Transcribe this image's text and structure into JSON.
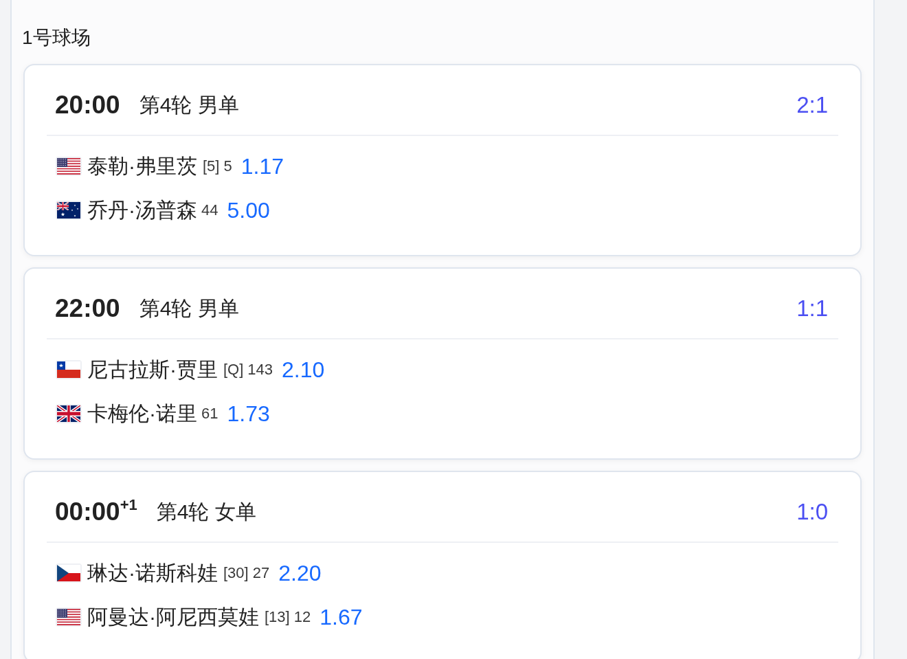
{
  "court": {
    "title": "1号球场"
  },
  "matches": [
    {
      "time": "20:00",
      "round": "第4轮 男单",
      "score": "2:1",
      "players": [
        {
          "flag": {
            "kind": "us"
          },
          "name": "泰勒·弗里茨",
          "seed": "[5]",
          "rank": "5",
          "odds": "1.17"
        },
        {
          "flag": {
            "kind": "au"
          },
          "name": "乔丹·汤普森",
          "rank": "44",
          "odds": "5.00"
        }
      ]
    },
    {
      "time": "22:00",
      "round": "第4轮 男单",
      "score": "1:1",
      "players": [
        {
          "flag": {
            "kind": "cl"
          },
          "name": "尼古拉斯·贾里",
          "seed": "[Q]",
          "rank": "143",
          "odds": "2.10"
        },
        {
          "flag": {
            "kind": "gb"
          },
          "name": "卡梅伦·诺里",
          "rank": "61",
          "odds": "1.73"
        }
      ]
    },
    {
      "time": "00:00$^{+1}$",
      "round": "第4轮 女单",
      "score": "1:0",
      "players": [
        {
          "flag": {
            "kind": "cz"
          },
          "name": "琳达·诺斯科娃",
          "seed": "[30]",
          "rank": "27",
          "odds": "2.20"
        },
        {
          "flag": {
            "kind": "us"
          },
          "name": "阿曼达·阿尼西莫娃",
          "seed": "[13]",
          "rank": "12",
          "odds": "1.67"
        }
      ]
    }
  ]
}
